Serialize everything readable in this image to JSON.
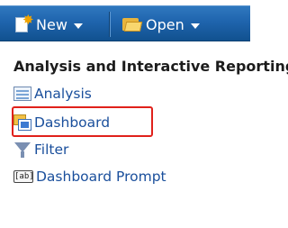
{
  "toolbar": {
    "new_label": "New",
    "open_label": "Open",
    "new_icon": "new-document-icon",
    "open_icon": "open-folder-icon"
  },
  "menu": {
    "heading": "Analysis and Interactive Reporting",
    "items": [
      {
        "label": "Analysis",
        "icon": "analysis-icon"
      },
      {
        "label": "Dashboard",
        "icon": "dashboard-icon"
      },
      {
        "label": "Filter",
        "icon": "filter-icon"
      },
      {
        "label": "Dashboard Prompt",
        "icon": "dashboard-prompt-icon",
        "icon_text": "[ab]"
      }
    ]
  },
  "colors": {
    "toolbar_bg": "#1f64ad",
    "link": "#1a4f9c",
    "highlight_border": "#e0211b"
  }
}
